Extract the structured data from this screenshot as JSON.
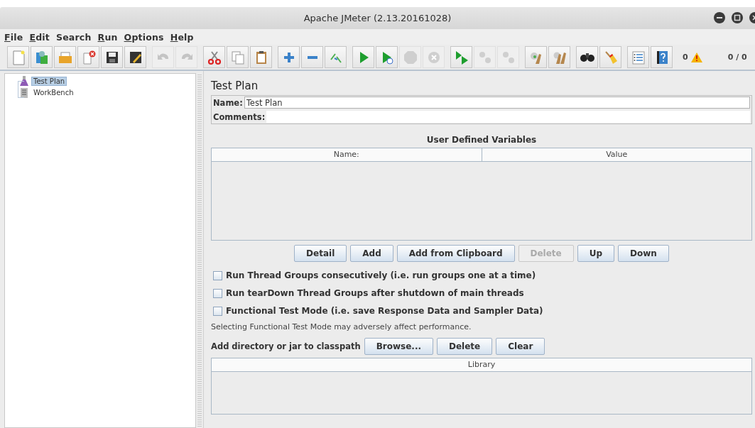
{
  "window": {
    "title": "Apache JMeter (2.13.20161028)",
    "controls": [
      {
        "kind": "minimize"
      },
      {
        "kind": "maximize"
      },
      {
        "kind": "close"
      }
    ]
  },
  "menu": [
    {
      "label": "File",
      "mnemonic": true
    },
    {
      "label": "Edit",
      "mnemonic": true
    },
    {
      "label": "Search",
      "mnemonic": false
    },
    {
      "label": "Run",
      "mnemonic": true
    },
    {
      "label": "Options",
      "mnemonic": true
    },
    {
      "label": "Help",
      "mnemonic": true
    }
  ],
  "toolbar": {
    "groups": [
      [
        {
          "kind": "new",
          "disabled": false
        },
        {
          "kind": "templates",
          "disabled": false
        },
        {
          "kind": "open",
          "disabled": false
        },
        {
          "kind": "close",
          "disabled": false
        },
        {
          "kind": "save",
          "disabled": false
        },
        {
          "kind": "save-as",
          "disabled": false
        }
      ],
      [
        {
          "kind": "undo",
          "disabled": true
        },
        {
          "kind": "redo",
          "disabled": true
        }
      ],
      [
        {
          "kind": "cut",
          "disabled": false
        },
        {
          "kind": "copy",
          "disabled": false
        },
        {
          "kind": "paste",
          "disabled": false
        }
      ],
      [
        {
          "kind": "expand",
          "disabled": false
        },
        {
          "kind": "collapse",
          "disabled": false
        },
        {
          "kind": "toggle",
          "disabled": false
        }
      ],
      [
        {
          "kind": "start",
          "disabled": false
        },
        {
          "kind": "start-no-pause",
          "disabled": false
        },
        {
          "kind": "stop",
          "disabled": true
        },
        {
          "kind": "shutdown",
          "disabled": true
        }
      ],
      [
        {
          "kind": "remote-start",
          "disabled": false
        },
        {
          "kind": "remote-stop",
          "disabled": true
        },
        {
          "kind": "remote-shutdown",
          "disabled": true
        }
      ],
      [
        {
          "kind": "clear",
          "disabled": false
        },
        {
          "kind": "clear-all",
          "disabled": false
        }
      ],
      [
        {
          "kind": "search",
          "disabled": false
        },
        {
          "kind": "reset-search",
          "disabled": false
        }
      ],
      [
        {
          "kind": "function-helper",
          "disabled": false
        },
        {
          "kind": "help",
          "disabled": false
        }
      ]
    ],
    "warnings": "0",
    "threads": "0 / 0"
  },
  "tree": [
    {
      "label": "Test Plan",
      "kind": "test-plan",
      "selected": true
    },
    {
      "label": "WorkBench",
      "kind": "workbench",
      "selected": false
    }
  ],
  "panel": {
    "title": "Test Plan",
    "name_label": "Name:",
    "name_value": "Test Plan",
    "comments_label": "Comments:",
    "variables": {
      "title": "User Defined Variables",
      "columns": [
        "Name:",
        "Value"
      ]
    },
    "buttons": [
      {
        "label": "Detail",
        "disabled": false
      },
      {
        "label": "Add",
        "disabled": false
      },
      {
        "label": "Add from Clipboard",
        "disabled": false
      },
      {
        "label": "Delete",
        "disabled": true
      },
      {
        "label": "Up",
        "disabled": false
      },
      {
        "label": "Down",
        "disabled": false
      }
    ],
    "options": [
      {
        "label": "Run Thread Groups consecutively (i.e. run groups one at a time)",
        "checked": false
      },
      {
        "label": "Run tearDown Thread Groups after shutdown of main threads",
        "checked": false
      },
      {
        "label": "Functional Test Mode (i.e. save Response Data and Sampler Data)",
        "checked": false
      }
    ],
    "note": "Selecting Functional Test Mode may adversely affect performance.",
    "classpath": {
      "label": "Add directory or jar to classpath",
      "buttons": [
        {
          "label": "Browse...",
          "disabled": false
        },
        {
          "label": "Delete",
          "disabled": false
        },
        {
          "label": "Clear",
          "disabled": false
        }
      ],
      "columns": [
        "Library"
      ]
    }
  }
}
